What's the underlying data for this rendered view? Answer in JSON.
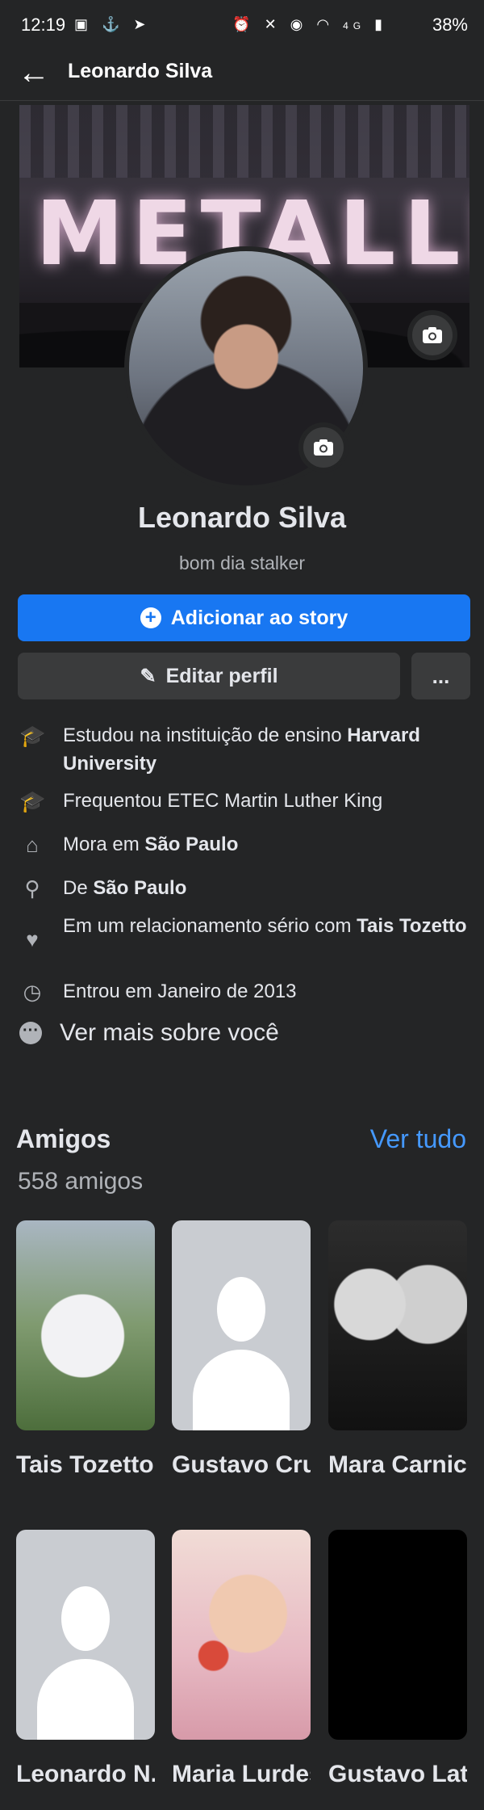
{
  "status_bar": {
    "time": "12:19",
    "battery": "38%",
    "network": "4G"
  },
  "nav": {
    "title": "Leonardo Silva"
  },
  "cover": {
    "text": "METALLIC"
  },
  "profile": {
    "name": "Leonardo Silva",
    "bio": "bom dia stalker"
  },
  "buttons": {
    "add_story": "Adicionar ao story",
    "edit_profile": "Editar perfil",
    "more": "..."
  },
  "details": [
    {
      "icon": "graduation-cap-icon",
      "prefix": "Estudou na instituição de ensino ",
      "bold": "Harvard University",
      "suffix": ""
    },
    {
      "icon": "graduation-cap-icon",
      "prefix": "Frequentou ETEC Martin Luther King",
      "bold": "",
      "suffix": ""
    },
    {
      "icon": "home-icon",
      "prefix": "Mora em ",
      "bold": "São Paulo",
      "suffix": ""
    },
    {
      "icon": "location-pin-icon",
      "prefix": "De ",
      "bold": "São Paulo",
      "suffix": ""
    },
    {
      "icon": "heart-icon",
      "prefix": "Em um relacionamento sério com ",
      "bold": "Tais Tozetto",
      "suffix": ""
    },
    {
      "icon": "clock-icon",
      "prefix": "Entrou em Janeiro de 2013",
      "bold": "",
      "suffix": ""
    }
  ],
  "more_about": "Ver mais sobre você",
  "friends": {
    "title": "Amigos",
    "see_all": "Ver tudo",
    "count": "558 amigos",
    "items": [
      {
        "name": "Tais Tozetto",
        "photo": "cat"
      },
      {
        "name": "Gustavo Cruz",
        "photo": "placeholder"
      },
      {
        "name": "Mara Carnic...",
        "photo": "couple"
      },
      {
        "name": "Leonardo N...",
        "photo": "placeholder"
      },
      {
        "name": "Maria Lurdes",
        "photo": "grandma"
      },
      {
        "name": "Gustavo Lat...",
        "photo": "black"
      }
    ]
  },
  "colors": {
    "background": "#242526",
    "accent": "#1877f2",
    "link": "#4599ff"
  }
}
